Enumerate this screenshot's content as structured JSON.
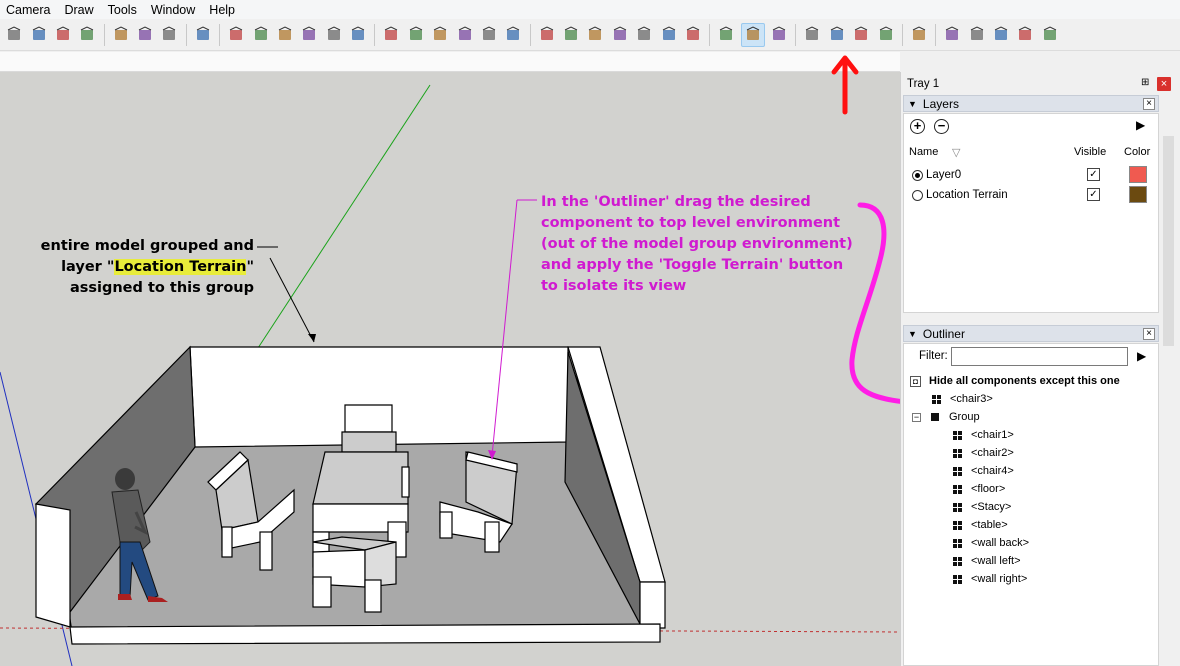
{
  "menu": [
    "Camera",
    "Draw",
    "Tools",
    "Window",
    "Help"
  ],
  "toolbar": {
    "icons": [
      "pencil-icon",
      "paint-icon",
      "eraser-icon",
      "cancel-icon",
      "undo-icon",
      "redo-icon",
      "print-icon",
      "extension-icon",
      "iso-view-icon",
      "top-view-icon",
      "front-view-icon",
      "right-view-icon",
      "back-view-icon",
      "left-view-icon",
      "xray-icon",
      "back-edges-icon",
      "wireframe-icon",
      "hidden-line-icon",
      "shaded-icon",
      "shaded-textures-icon",
      "sandbox-icon",
      "sandbox-scratch-icon",
      "smoove-icon",
      "stamp-icon",
      "drape-icon",
      "add-detail-icon",
      "flip-edge-icon",
      "add-location-icon",
      "toggle-terrain-icon",
      "photo-textures-icon",
      "warehouse-icon",
      "share-model-icon",
      "share-component-icon",
      "extension-warehouse-icon",
      "section-icon",
      "style-1-icon",
      "style-2-icon",
      "style-3-icon",
      "style-4-icon",
      "style-5-icon"
    ],
    "active": "toggle-terrain-icon"
  },
  "viewport": {
    "annotation_left": {
      "line1": "entire model grouped and",
      "line2_pre": "layer \"",
      "line2_hl": "Location Terrain",
      "line2_post": "\"",
      "line3": "assigned to this group"
    },
    "annotation_right": {
      "line1": "In the 'Outliner' drag the desired",
      "line2": "component to top level environment",
      "line3": "(out of the model group environment)",
      "line4": "and apply the 'Toggle Terrain' button",
      "line5": "to isolate its view"
    },
    "colors": {
      "annotation_magenta": "#d01ad0",
      "highlight_yellow": "#e8ec3a",
      "arrow_red": "#ff1010"
    }
  },
  "tray": {
    "title": "Tray 1",
    "pin": "⊞",
    "close": "×"
  },
  "layers": {
    "header": "Layers",
    "col_name": "Name",
    "col_visible": "Visible",
    "col_color": "Color",
    "rows": [
      {
        "name": "Layer0",
        "active": true,
        "visible": true,
        "color": "#f05a50"
      },
      {
        "name": "Location Terrain",
        "active": false,
        "visible": true,
        "color": "#6b4a10"
      }
    ]
  },
  "outliner": {
    "header": "Outliner",
    "filter_label": "Filter:",
    "filter_value": "",
    "hide_label": "Hide all components except this one",
    "top_component": "<chair3>",
    "group": "Group",
    "children": [
      "<chair1>",
      "<chair2>",
      "<chair4>",
      "<floor>",
      "<Stacy>",
      "<table>",
      "<wall back>",
      "<wall left>",
      "<wall right>"
    ]
  }
}
